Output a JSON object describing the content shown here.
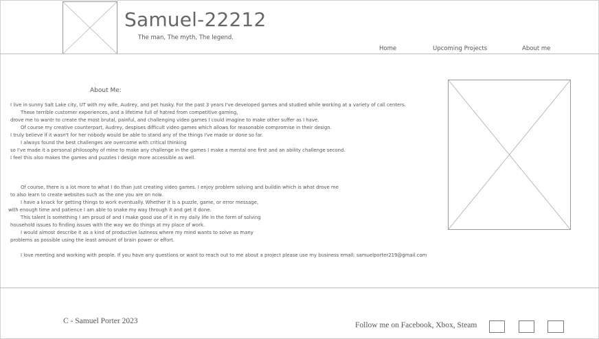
{
  "header": {
    "title": "Samuel-22212",
    "subtitle": "The man, The myth, The legend."
  },
  "nav": {
    "items": [
      {
        "label": "Home"
      },
      {
        "label": "Upcoming Projects"
      },
      {
        "label": "About me"
      }
    ]
  },
  "about": {
    "heading": "About Me:",
    "lines": [
      "I live in sunny Salt Lake city, UT with my wife, Audrey, and pet husky. For the past 3 years I've developed games and studied while working at a variety of call centers.",
      "These terrible customer experiences, and a lifetime full of hatred from competitive gaming,",
      "drove me to wantr to create the most brutal, painful, and challenging video games I could imagine to make other suffer as I have.",
      "Of course my creative counterpart, Audrey, despises difficult video games which allows for reasonable compromise in their design.",
      "I truly believe if it wasn't for her nobody would be able to stand any of the things I've made or done so far.",
      "I always found the best challenges are overcome with critical thinking",
      "so I've made it a personal philosophy of mine to make any challenge in the games I make a mental one first and an ability challenge second.",
      "I feel this also makes the games and puzzles I design more accessible as well.",
      "Of course, there is a lot more to what I do than just creating video games. I enjoy problem solving and buildin which is what drove me",
      "to also learn to create websites such as the one you are on now.",
      "I have a knack for getting things to work eventually. Whether it is a puzzle, game, or error message,",
      "with enough time and patience I am able to snake my way through it and get it done.",
      "This talent is something I am proud of and I make good use of it in my daily life in the form of solving",
      "household issues to finding issues with the way we do things at my place of work.",
      "I would almost describe it as a kind of productive laziness where my mind wants to solve as many",
      "problems as possible using the least amount of brain power or effort.",
      "I love meeting and working with people. If you have any questions or want to reach out to me about a project please use my business email: samuelporter219@gmail.com"
    ]
  },
  "footer": {
    "copyright": "C - Samuel Porter 2023",
    "follow_text": "Follow me on Facebook, Xbox, Steam"
  }
}
